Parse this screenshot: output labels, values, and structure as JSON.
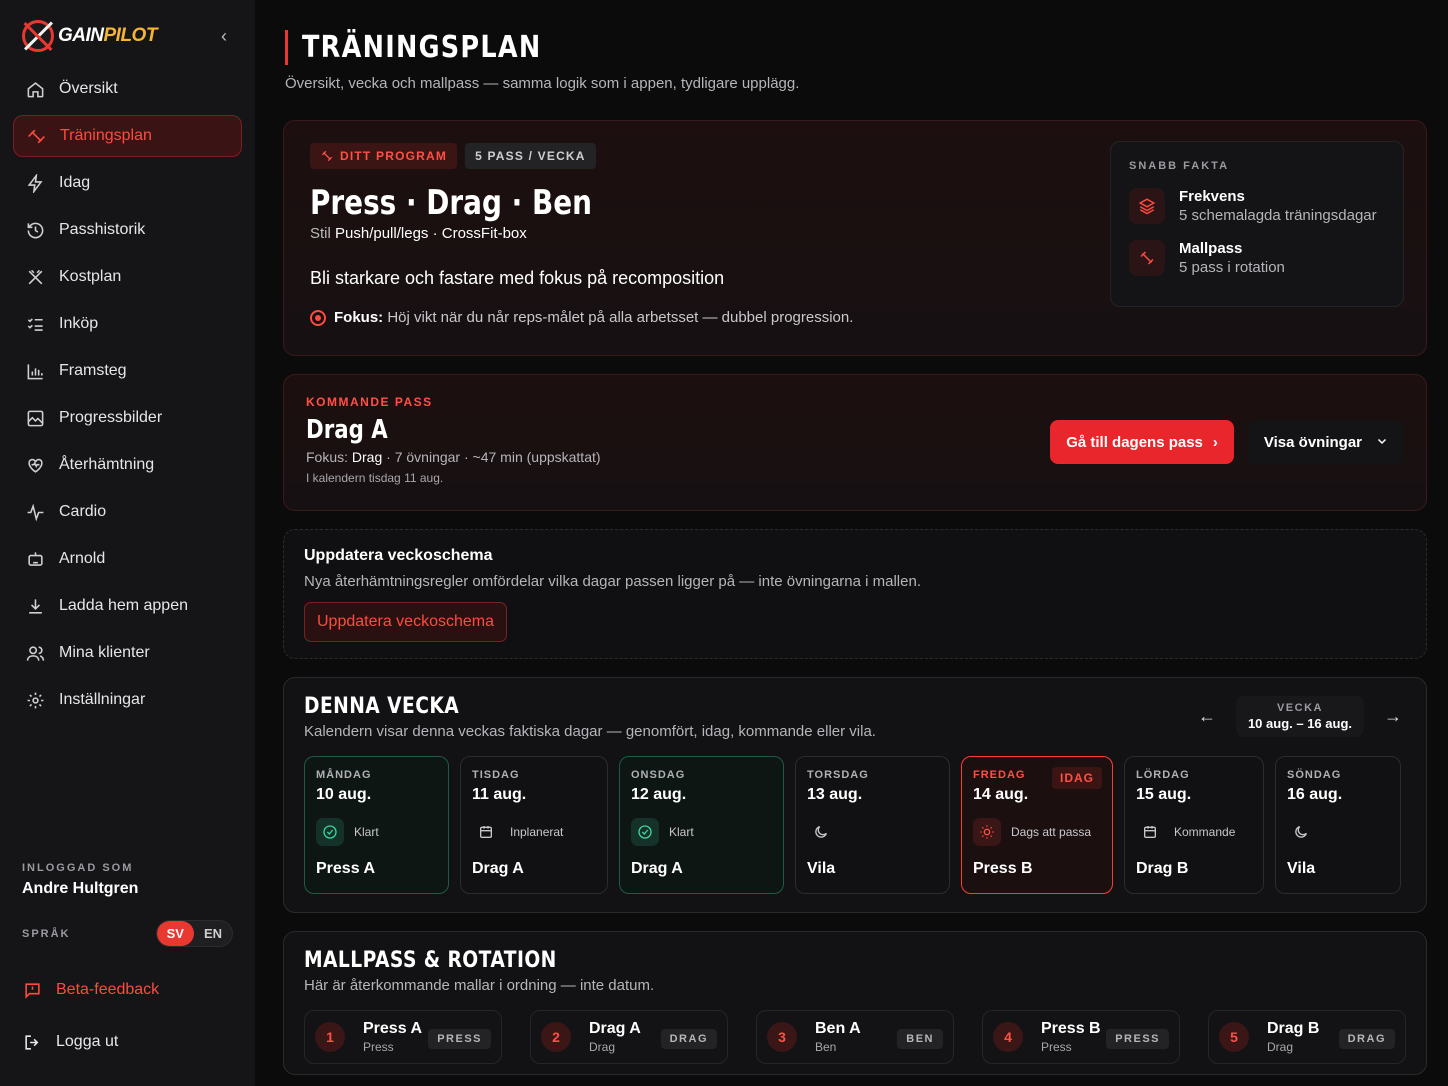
{
  "brand": {
    "name_part1": "GAIN",
    "name_part2": "PILOT"
  },
  "sidebar": {
    "items": [
      {
        "label": "Översikt",
        "icon": "home-icon"
      },
      {
        "label": "Träningsplan",
        "icon": "dumbbell-icon",
        "active": true
      },
      {
        "label": "Idag",
        "icon": "bolt-icon"
      },
      {
        "label": "Passhistorik",
        "icon": "history-icon"
      },
      {
        "label": "Kostplan",
        "icon": "utensils-icon"
      },
      {
        "label": "Inköp",
        "icon": "checklist-icon"
      },
      {
        "label": "Framsteg",
        "icon": "bar-chart-icon"
      },
      {
        "label": "Progressbilder",
        "icon": "image-icon"
      },
      {
        "label": "Återhämtning",
        "icon": "heart-icon"
      },
      {
        "label": "Cardio",
        "icon": "pulse-icon"
      },
      {
        "label": "Arnold",
        "icon": "robot-icon"
      },
      {
        "label": "Ladda hem appen",
        "icon": "download-icon"
      },
      {
        "label": "Mina klienter",
        "icon": "users-icon"
      },
      {
        "label": "Inställningar",
        "icon": "gear-icon"
      }
    ],
    "logged_in_label": "INLOGGAD SOM",
    "user_name": "Andre Hultgren",
    "language_label": "SPRÅK",
    "lang_sv": "SV",
    "lang_en": "EN",
    "feedback": "Beta-feedback",
    "logout": "Logga ut"
  },
  "header": {
    "title": "TRÄNINGSPLAN",
    "subtitle": "Översikt, vecka och mallpass — samma logik som i appen, tydligare upplägg."
  },
  "program": {
    "tag_program": "DITT PROGRAM",
    "tag_freq": "5 PASS / VECKA",
    "title": "Press · Drag · Ben",
    "style_label": "Stil",
    "style_value": "Push/pull/legs · CrossFit-box",
    "goal": "Bli starkare och fastare med fokus på recomposition",
    "focus_label": "Fokus:",
    "focus_text": "Höj vikt när du når reps-målet på alla arbetsset — dubbel progression.",
    "facts_title": "SNABB FAKTA",
    "facts": [
      {
        "title": "Frekvens",
        "desc": "5 schemalagda träningsdagar"
      },
      {
        "title": "Mallpass",
        "desc": "5 pass i rotation"
      }
    ]
  },
  "upcoming": {
    "kicker": "KOMMANDE PASS",
    "title": "Drag A",
    "focus_label": "Fokus:",
    "focus_value": "Drag",
    "meta_rest": "· 7 övningar · ~47 min (uppskattat)",
    "calendar": "I kalendern tisdag 11 aug.",
    "primary_button": "Gå till dagens pass",
    "secondary_button": "Visa övningar"
  },
  "update": {
    "title": "Uppdatera veckoschema",
    "desc": "Nya återhämtningsregler omfördelar vilka dagar passen ligger på — inte övningarna i mallen.",
    "button": "Uppdatera veckoschema"
  },
  "week": {
    "title": "DENNA VECKA",
    "desc": "Kalendern visar denna veckas faktiska dagar — genomfört, idag, kommande eller vila.",
    "week_label": "VECKA",
    "week_range": "10 aug. – 16 aug.",
    "today_badge": "IDAG",
    "days": [
      {
        "name": "MÅNDAG",
        "date": "10 aug.",
        "status": "Klart",
        "workout": "Press A",
        "state": "done"
      },
      {
        "name": "TISDAG",
        "date": "11 aug.",
        "status": "Inplanerat",
        "workout": "Drag A",
        "state": "planned"
      },
      {
        "name": "ONSDAG",
        "date": "12 aug.",
        "status": "Klart",
        "workout": "Drag A",
        "state": "done"
      },
      {
        "name": "TORSDAG",
        "date": "13 aug.",
        "status": "",
        "workout": "Vila",
        "state": "rest"
      },
      {
        "name": "FREDAG",
        "date": "14 aug.",
        "status": "Dags att passa",
        "workout": "Press B",
        "state": "today"
      },
      {
        "name": "LÖRDAG",
        "date": "15 aug.",
        "status": "Kommande",
        "workout": "Drag B",
        "state": "planned"
      },
      {
        "name": "SÖNDAG",
        "date": "16 aug.",
        "status": "",
        "workout": "Vila",
        "state": "rest"
      }
    ]
  },
  "rotation": {
    "title": "MALLPASS & ROTATION",
    "desc": "Här är återkommande mallar i ordning — inte datum.",
    "items": [
      {
        "num": "1",
        "name": "Press A",
        "cat": "Press",
        "tag": "PRESS"
      },
      {
        "num": "2",
        "name": "Drag A",
        "cat": "Drag",
        "tag": "DRAG"
      },
      {
        "num": "3",
        "name": "Ben A",
        "cat": "Ben",
        "tag": "BEN"
      },
      {
        "num": "4",
        "name": "Press B",
        "cat": "Press",
        "tag": "PRESS"
      },
      {
        "num": "5",
        "name": "Drag B",
        "cat": "Drag",
        "tag": "DRAG"
      }
    ]
  },
  "colors": {
    "accent": "#e8382f",
    "done": "#3fd39a",
    "bg": "#0b0b0c"
  }
}
